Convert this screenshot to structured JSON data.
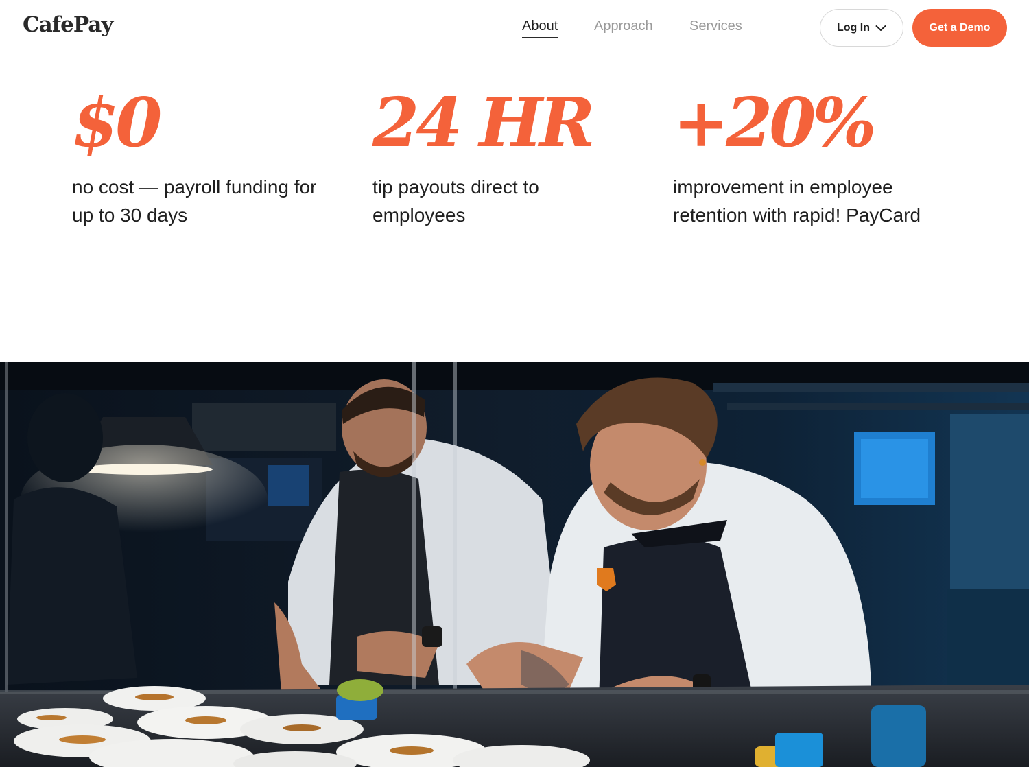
{
  "header": {
    "logo": "CafePay",
    "nav": [
      {
        "label": "About",
        "active": true
      },
      {
        "label": "Approach",
        "active": false
      },
      {
        "label": "Services",
        "active": false
      }
    ],
    "login_label": "Log In",
    "login_icon": "chevron-down-icon",
    "demo_label": "Get a Demo"
  },
  "stats": [
    {
      "value": "$0",
      "description": "no cost — payroll funding for up to 30 days"
    },
    {
      "value": "24 HR",
      "description": "tip payouts direct to employees"
    },
    {
      "value": "+20%",
      "description": "improvement in employee retention with rapid! PayCard"
    }
  ],
  "hero": {
    "subject": "two chefs plating dishes in a dim blue-lit restaurant kitchen"
  },
  "colors": {
    "accent": "#f4623a",
    "text": "#1f1f1f",
    "nav_inactive": "#9a9a9a",
    "background": "#ffffff"
  }
}
